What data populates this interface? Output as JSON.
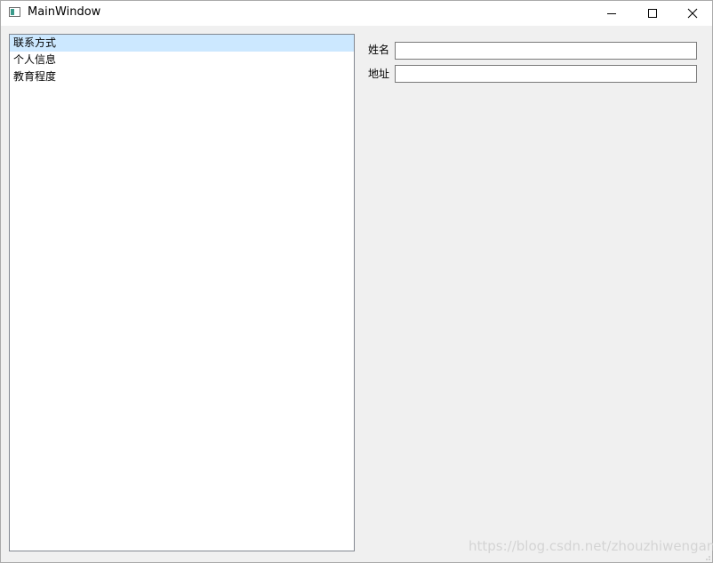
{
  "window": {
    "title": "MainWindow",
    "icon": "app-window-icon",
    "controls": {
      "minimize": "minimize-icon",
      "maximize": "maximize-icon",
      "close": "close-icon"
    }
  },
  "list": {
    "items": [
      {
        "label": "联系方式",
        "selected": true
      },
      {
        "label": "个人信息",
        "selected": false
      },
      {
        "label": "教育程度",
        "selected": false
      }
    ]
  },
  "form": {
    "name_label": "姓名",
    "name_value": "",
    "address_label": "地址",
    "address_value": ""
  },
  "watermark": "https://blog.csdn.net/zhouzhiwengang",
  "colors": {
    "selection": "#cce8ff",
    "background": "#f0f0f0",
    "list_border": "#828790"
  }
}
